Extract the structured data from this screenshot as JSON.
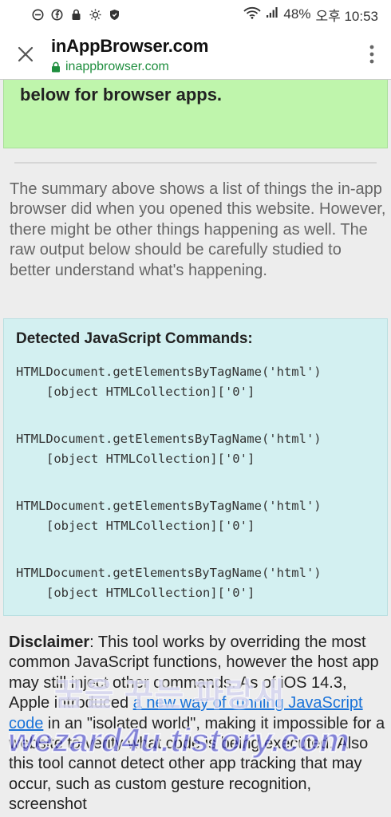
{
  "status_bar": {
    "battery": "48%",
    "time": "오후 10:53"
  },
  "header": {
    "title": "inAppBrowser.com",
    "url": "inappbrowser.com"
  },
  "green_box": {
    "text": "below for browser apps."
  },
  "summary": {
    "text": "The summary above shows a list of things the in-app browser did when you opened this website. However, there might be other things happening as well. The raw output below should be carefully studied to better understand what's happening."
  },
  "js_commands": {
    "heading": "Detected JavaScript Commands:",
    "items": [
      {
        "call": "HTMLDocument.getElementsByTagName('html')",
        "value": "[object HTMLCollection]['0']"
      },
      {
        "call": "HTMLDocument.getElementsByTagName('html')",
        "value": "[object HTMLCollection]['0']"
      },
      {
        "call": "HTMLDocument.getElementsByTagName('html')",
        "value": "[object HTMLCollection]['0']"
      },
      {
        "call": "HTMLDocument.getElementsByTagName('html')",
        "value": "[object HTMLCollection]['0']"
      }
    ]
  },
  "disclaimer": {
    "label": "Disclaimer",
    "text_1": ": This tool works by overriding the most common JavaScript functions, however the host app may still inject other commands. As of iOS 14.3, Apple introduced ",
    "link": "a new way of running JavaScript code",
    "text_2": " in an \"isolated world\", making it impossible for a website to verify what code is being executed. Also this tool cannot detect other app tracking that may occur, such as custom gesture recognition, screenshot"
  },
  "watermark": {
    "line1": "꿈을 꾸는 파랑새",
    "line2": "wezard4u.tistory.com"
  },
  "colors": {
    "green_box": "#bff5ac",
    "js_box": "#d3f0f1",
    "link": "#1a73d9",
    "url_green": "#1e8e3e"
  }
}
